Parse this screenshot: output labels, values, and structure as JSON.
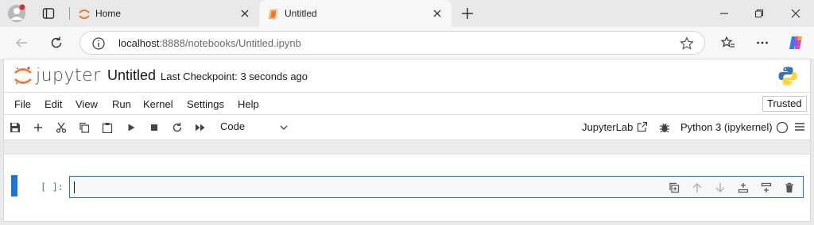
{
  "browser": {
    "tabs": [
      {
        "title": "Home",
        "active": false
      },
      {
        "title": "Untitled",
        "active": true
      }
    ],
    "url_host": "localhost",
    "url_path": ":8888/notebooks/Untitled.ipynb"
  },
  "notebook": {
    "logo_text": "jupyter",
    "title": "Untitled",
    "checkpoint": "Last Checkpoint: 3 seconds ago",
    "menu": [
      "File",
      "Edit",
      "View",
      "Run",
      "Kernel",
      "Settings",
      "Help"
    ],
    "trusted": "Trusted",
    "cell_type": "Code",
    "jupyterlab_link": "JupyterLab",
    "kernel": "Python 3 (ipykernel)",
    "cell": {
      "prompt": "[ ]:",
      "source": ""
    }
  },
  "colors": {
    "accent": "#1976d2",
    "prompt": "#307fc1",
    "jupyter_orange": "#f37726"
  }
}
